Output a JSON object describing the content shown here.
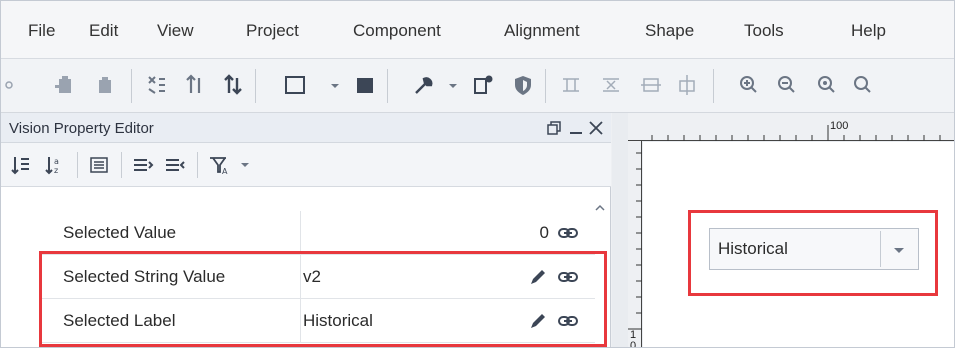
{
  "menu": {
    "items": [
      "File",
      "Edit",
      "View",
      "Project",
      "Component",
      "Alignment",
      "Shape",
      "Tools",
      "Help"
    ]
  },
  "toolbar": {
    "icons": [
      "paste-icon",
      "clipboard-icon",
      "clipboard-empty-icon",
      "group-icon",
      "sort-icon",
      "sort-active-icon",
      "rectangle-icon",
      "dropdown-icon",
      "fill-square-icon",
      "wrench-icon",
      "dropdown-icon",
      "script-icon",
      "shield-icon",
      "align-icon",
      "distribute-icon",
      "align-center-icon",
      "align-middle-icon",
      "zoom-in-icon",
      "zoom-out-icon",
      "zoom-fit-icon"
    ]
  },
  "property_editor": {
    "title": "Vision Property Editor",
    "controls": [
      "restore-icon",
      "minimize-icon",
      "close-icon"
    ],
    "toolbar_icons": [
      "sort-ascending-icon",
      "sort-alpha-icon",
      "list-icon",
      "expand-all-icon",
      "collapse-all-icon",
      "filter-icon",
      "filter-dropdown-icon"
    ],
    "rows": [
      {
        "name": "Selected Value",
        "value": "",
        "number": "0",
        "edit": false,
        "bound": true
      },
      {
        "name": "Selected String Value",
        "value": "v2",
        "number": "",
        "edit": true,
        "bound": true
      },
      {
        "name": "Selected Label",
        "value": "Historical",
        "number": "",
        "edit": true,
        "bound": true
      }
    ]
  },
  "designer": {
    "ruler_top_label": "100",
    "ruler_left_labels": [
      "1",
      "0"
    ],
    "dropdown": {
      "selected": "Historical"
    }
  },
  "colors": {
    "highlight": "#e8383d",
    "panel_title_bg": "#e9edf3",
    "icon": "#333f4f"
  }
}
